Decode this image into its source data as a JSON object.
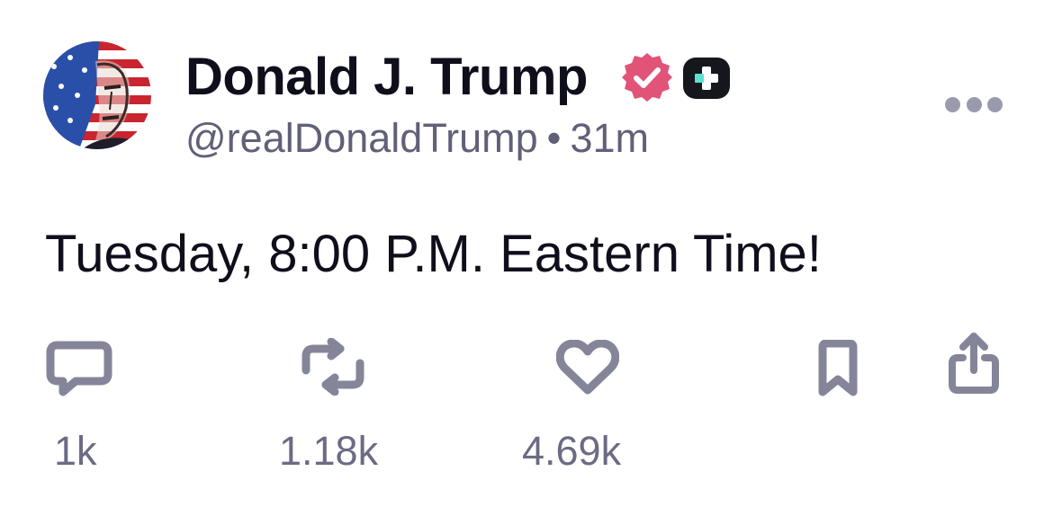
{
  "author": {
    "display_name": "Donald J. Trump",
    "handle": "@realDonaldTrump",
    "separator": "•",
    "posted_ago": "31m",
    "avatar_icon": "flag-portrait-avatar",
    "verified_icon": "verified-badge-icon",
    "plus_icon": "plus-badge-icon"
  },
  "post": {
    "text": "Tuesday, 8:00 P.M. Eastern Time!"
  },
  "actions": {
    "reply": {
      "icon": "reply-icon",
      "count": "1k"
    },
    "repost": {
      "icon": "repost-icon",
      "count": "1.18k"
    },
    "like": {
      "icon": "heart-icon",
      "count": "4.69k"
    },
    "bookmark": {
      "icon": "bookmark-icon"
    },
    "share": {
      "icon": "share-icon"
    },
    "more": {
      "icon": "more-icon"
    }
  },
  "colors": {
    "text_primary": "#0f0f1c",
    "text_secondary": "#606079",
    "icon_gray": "#85859a",
    "verified_pink": "#e25378",
    "badge_dark": "#16161d",
    "badge_teal": "#5ce0d0"
  }
}
